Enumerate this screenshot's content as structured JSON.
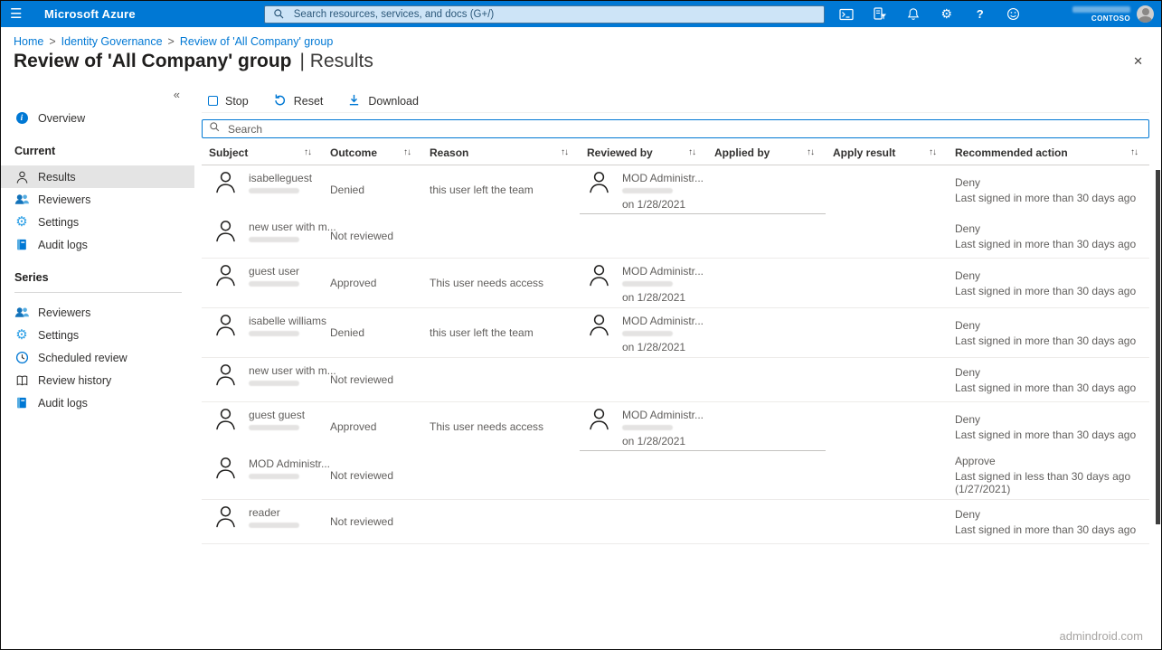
{
  "colors": {
    "accent": "#0078d4",
    "topbar": "#0078d4",
    "selected_nav_bg": "#e4e4e4"
  },
  "topbar": {
    "brand": "Microsoft Azure",
    "search_placeholder": "Search resources, services, and docs (G+/)",
    "account_label": "CONTOSO",
    "icons": [
      "cloud-shell-icon",
      "directory-filter-icon",
      "notifications-bell-icon",
      "settings-gear-icon",
      "help-icon",
      "feedback-smiley-icon"
    ]
  },
  "breadcrumb": {
    "separator": ">",
    "items": [
      "Home",
      "Identity Governance",
      "Review of 'All Company' group"
    ]
  },
  "page": {
    "title": "Review of 'All Company' group",
    "title_suffix": "| Results",
    "close_glyph": "✕"
  },
  "sidebar": {
    "collapse_icon": "«",
    "overview_label": "Overview",
    "sections": [
      {
        "title": "Current",
        "divider": false,
        "items": [
          {
            "label": "Results",
            "icon": "person-icon",
            "selected": true
          },
          {
            "label": "Reviewers",
            "icon": "people-icon",
            "selected": false
          },
          {
            "label": "Settings",
            "icon": "gear-icon",
            "selected": false
          },
          {
            "label": "Audit logs",
            "icon": "audit-log-icon",
            "selected": false
          }
        ]
      },
      {
        "title": "Series",
        "divider": true,
        "items": [
          {
            "label": "Reviewers",
            "icon": "people-icon",
            "selected": false
          },
          {
            "label": "Settings",
            "icon": "gear-icon",
            "selected": false
          },
          {
            "label": "Scheduled review",
            "icon": "clock-icon",
            "selected": false
          },
          {
            "label": "Review history",
            "icon": "book-icon",
            "selected": false
          },
          {
            "label": "Audit logs",
            "icon": "audit-log-icon",
            "selected": false
          }
        ]
      }
    ]
  },
  "toolbar": {
    "stop_label": "Stop",
    "reset_label": "Reset",
    "download_label": "Download"
  },
  "main": {
    "search_placeholder": "Search"
  },
  "table": {
    "sort_glyph": "↑↓",
    "columns": [
      "Subject",
      "Outcome",
      "Reason",
      "Reviewed by",
      "Applied by",
      "Apply result",
      "Recommended action"
    ],
    "rows": [
      {
        "subject": "isabelleguest",
        "outcome": "Denied",
        "reason": "this user left the team",
        "reviewed_by": "MOD Administr...",
        "reviewed_on": "on 1/28/2021",
        "applied_by": "",
        "apply_result": "",
        "recommended_action": "Deny",
        "recommended_detail": "Last signed in more than 30 days ago",
        "separator": "partial"
      },
      {
        "subject": "new user with m...",
        "outcome": "Not reviewed",
        "reason": "",
        "reviewed_by": "",
        "reviewed_on": "",
        "applied_by": "",
        "apply_result": "",
        "recommended_action": "Deny",
        "recommended_detail": "Last signed in more than 30 days ago",
        "separator": "full"
      },
      {
        "subject": "guest user",
        "outcome": "Approved",
        "reason": "This user needs access",
        "reviewed_by": "MOD Administr...",
        "reviewed_on": "on 1/28/2021",
        "applied_by": "",
        "apply_result": "",
        "recommended_action": "Deny",
        "recommended_detail": "Last signed in more than 30 days ago",
        "separator": "full"
      },
      {
        "subject": "isabelle williams",
        "outcome": "Denied",
        "reason": "this user left the team",
        "reviewed_by": "MOD Administr...",
        "reviewed_on": "on 1/28/2021",
        "applied_by": "",
        "apply_result": "",
        "recommended_action": "Deny",
        "recommended_detail": "Last signed in more than 30 days ago",
        "separator": "full"
      },
      {
        "subject": "new user with m...",
        "outcome": "Not reviewed",
        "reason": "",
        "reviewed_by": "",
        "reviewed_on": "",
        "applied_by": "",
        "apply_result": "",
        "recommended_action": "Deny",
        "recommended_detail": "Last signed in more than 30 days ago",
        "separator": "full"
      },
      {
        "subject": "guest guest",
        "outcome": "Approved",
        "reason": "This user needs access",
        "reviewed_by": "MOD Administr...",
        "reviewed_on": "on 1/28/2021",
        "applied_by": "",
        "apply_result": "",
        "recommended_action": "Deny",
        "recommended_detail": "Last signed in more than 30 days ago",
        "separator": "partial"
      },
      {
        "subject": "MOD Administr...",
        "outcome": "Not reviewed",
        "reason": "",
        "reviewed_by": "",
        "reviewed_on": "",
        "applied_by": "",
        "apply_result": "",
        "recommended_action": "Approve",
        "recommended_detail": "Last signed in less than 30 days ago (1/27/2021)",
        "separator": "full"
      },
      {
        "subject": "reader",
        "outcome": "Not reviewed",
        "reason": "",
        "reviewed_by": "",
        "reviewed_on": "",
        "applied_by": "",
        "apply_result": "",
        "recommended_action": "Deny",
        "recommended_detail": "Last signed in more than 30 days ago",
        "separator": "full"
      }
    ]
  },
  "watermark": "admindroid.com"
}
